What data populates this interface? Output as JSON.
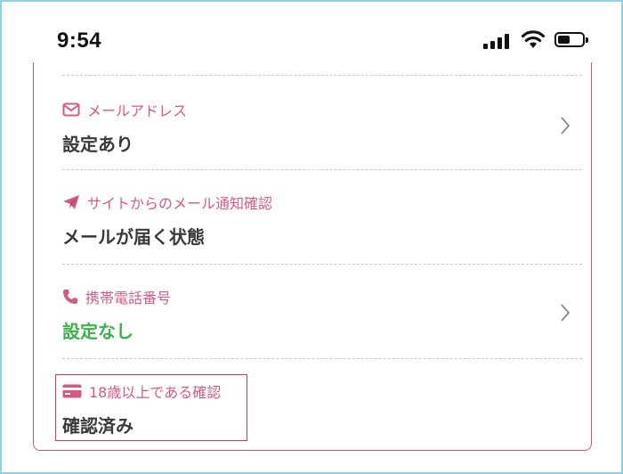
{
  "status_bar": {
    "time": "9:54",
    "icons": [
      "signal-icon",
      "wifi-icon",
      "battery-icon"
    ]
  },
  "colors": {
    "accent": "#d45a84",
    "green": "#3bb04b",
    "frame": "#8fd3e3"
  },
  "settings": [
    {
      "icon": "envelope-icon",
      "label": "メールアドレス",
      "value": "設定あり",
      "has_chevron": true
    },
    {
      "icon": "paper-plane-icon",
      "label": "サイトからのメール通知確認",
      "value": "メールが届く状態",
      "has_chevron": false
    },
    {
      "icon": "phone-icon",
      "label": "携帯電話番号",
      "value": "設定なし",
      "has_chevron": true
    },
    {
      "icon": "credit-card-icon",
      "label": "18歳以上である確認",
      "value": "確認済み",
      "has_chevron": false
    }
  ]
}
